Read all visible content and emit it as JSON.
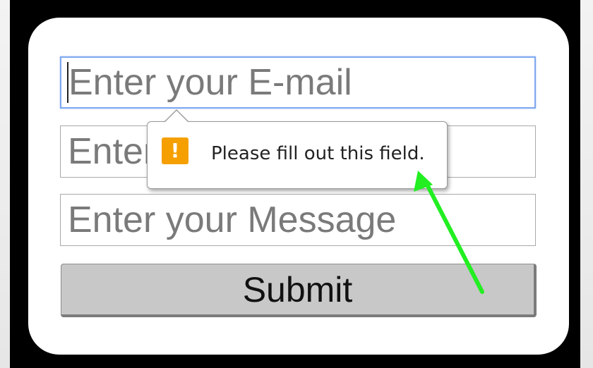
{
  "form": {
    "email_placeholder": "Enter your E-mail",
    "name_placeholder": "Enter your Name",
    "message_placeholder": "Enter your Message",
    "submit_label": "Submit"
  },
  "validation": {
    "message": "Please fill out this field.",
    "icon": "warning-icon",
    "icon_glyph": "!",
    "icon_color": "#f5a000"
  },
  "colors": {
    "focus_border": "#7fa8f0",
    "annotation_arrow": "#22ee22",
    "panel_background": "#000000"
  }
}
